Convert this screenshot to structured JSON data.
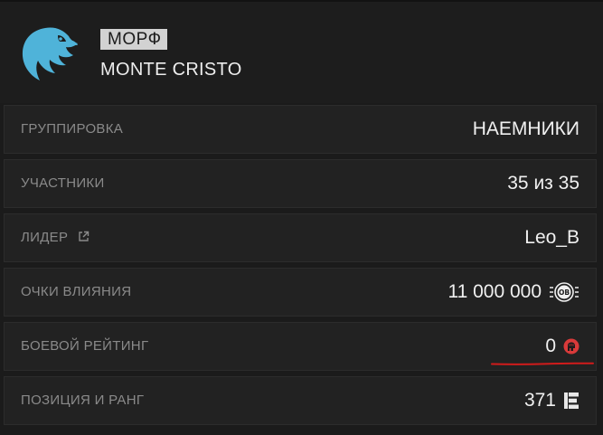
{
  "clan": {
    "tag": "МОРФ",
    "name": "MONTE CRISTO",
    "brand_color": "#4fb3d9"
  },
  "rows": [
    {
      "label": "ГРУППИРОВКА",
      "value": "НАЕМНИКИ"
    },
    {
      "label": "УЧАСТНИКИ",
      "value": "35 из 35"
    },
    {
      "label": "ЛИДЕР",
      "value": "Leo_B",
      "icon": "external-link-icon"
    },
    {
      "label": "ОЧКИ ВЛИЯНИЯ",
      "value": "11 000 000",
      "icon": "influence-points-icon",
      "icon_text": "ОВ"
    },
    {
      "label": "БОЕВОЙ РЕЙТИНГ",
      "value": "0",
      "icon": "fist-icon",
      "icon_color": "#d93a3a"
    },
    {
      "label": "ПОЗИЦИЯ И РАНГ",
      "value": "371",
      "icon": "rank-icon"
    }
  ],
  "annotation": {
    "color": "#d11b1b"
  }
}
